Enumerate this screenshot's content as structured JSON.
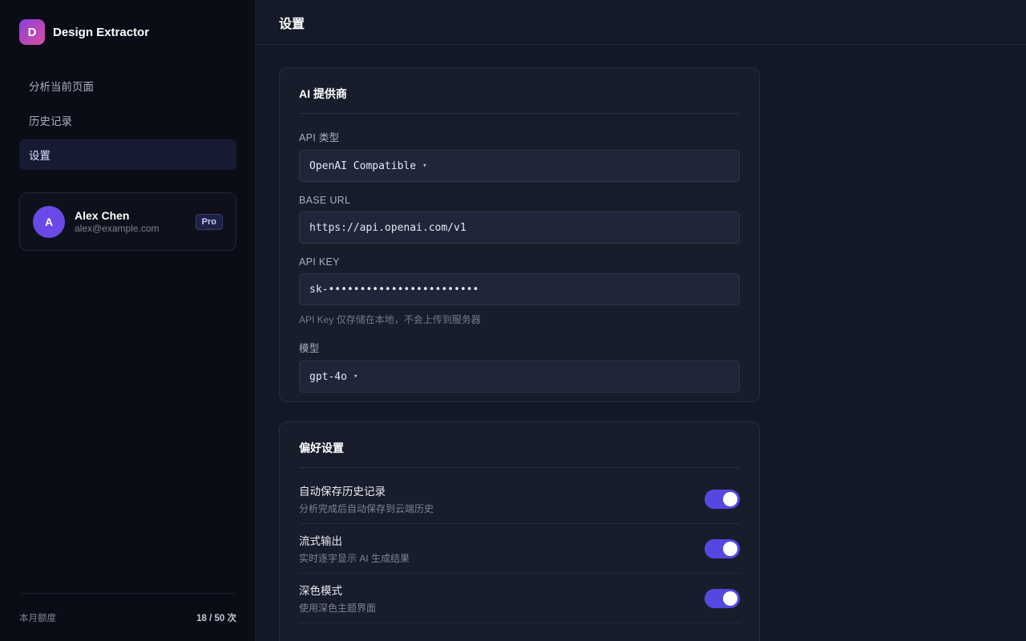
{
  "brand": {
    "logo_letter": "D",
    "name": "Design Extractor"
  },
  "nav": {
    "items": [
      {
        "label": "分析当前页面"
      },
      {
        "label": "历史记录"
      },
      {
        "label": "设置"
      }
    ],
    "active": "设置"
  },
  "user": {
    "avatar_letter": "A",
    "name": "Alex Chen",
    "email": "alex@example.com",
    "plan_badge": "Pro"
  },
  "quota": {
    "label": "本月额度",
    "value": "18 / 50 次"
  },
  "header": {
    "title": "设置"
  },
  "ai_provider": {
    "title": "AI 提供商",
    "api_type": {
      "label": "API 类型",
      "value": "OpenAI Compatible",
      "caret": "▾"
    },
    "base_url": {
      "label": "BASE URL",
      "value": "https://api.openai.com/v1"
    },
    "api_key": {
      "label": "API KEY",
      "value": "sk-••••••••••••••••••••••••",
      "hint": "API Key 仅存储在本地，不会上传到服务器"
    },
    "model": {
      "label": "模型",
      "value": "gpt-4o",
      "caret": "▾"
    }
  },
  "preferences": {
    "title": "偏好设置",
    "items": [
      {
        "title": "自动保存历史记录",
        "desc": "分析完成后自动保存到云端历史",
        "enabled": true
      },
      {
        "title": "流式输出",
        "desc": "实时逐字显示 AI 生成结果",
        "enabled": true
      },
      {
        "title": "深色模式",
        "desc": "使用深色主题界面",
        "enabled": true
      }
    ]
  },
  "colors": {
    "accent": "#5548e0",
    "sidebar_bg": "#0a0d16",
    "main_bg": "#131826",
    "card_bg": "#181d2c"
  }
}
